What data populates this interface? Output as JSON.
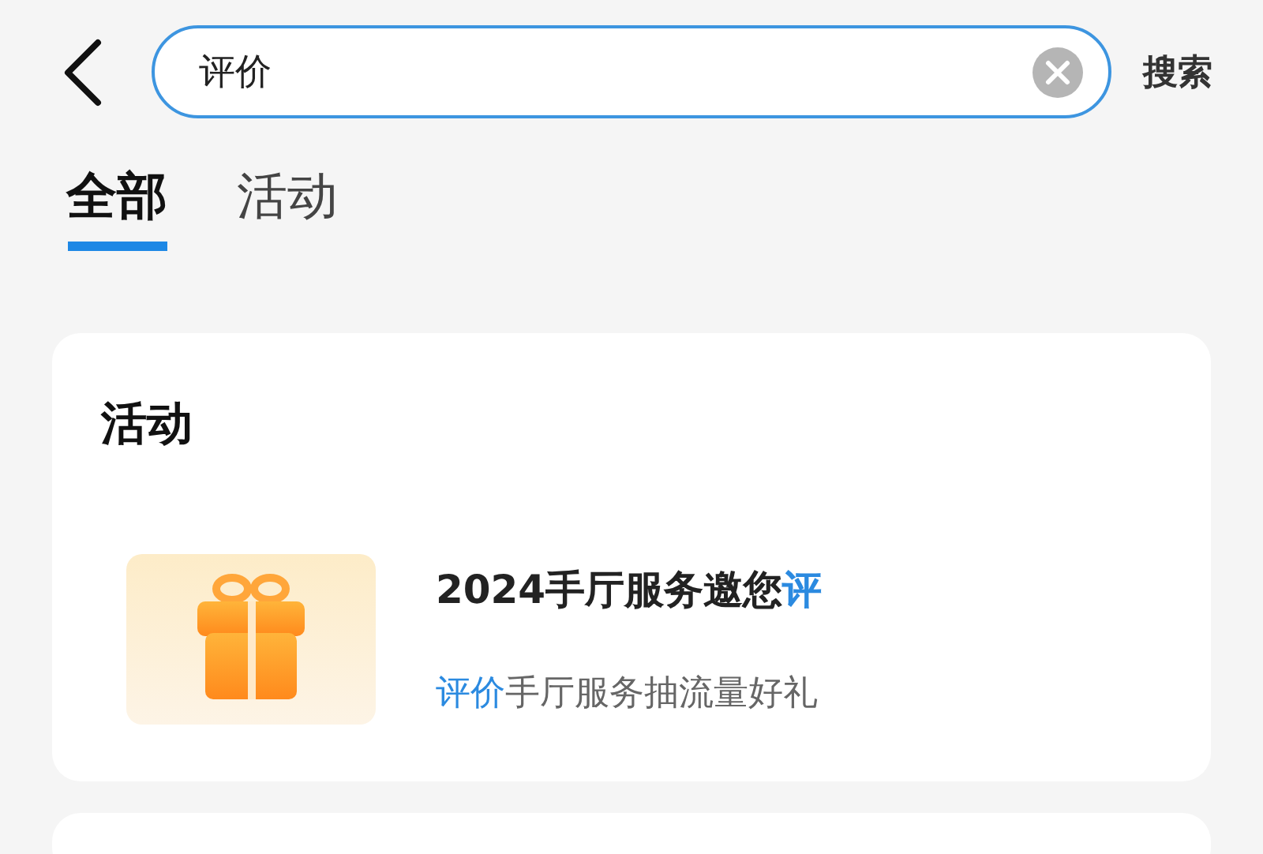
{
  "search": {
    "value": "评价",
    "submit": "搜索"
  },
  "tabs": [
    {
      "label": "全部",
      "selected": true
    },
    {
      "label": "活动",
      "selected": false
    }
  ],
  "sections": [
    {
      "title": "活动",
      "items": [
        {
          "title": [
            {
              "text": "2024手厅服务邀您",
              "highlight": false
            },
            {
              "text": "评",
              "highlight": true
            }
          ],
          "subtitle": [
            {
              "text": "评价",
              "highlight": true
            },
            {
              "text": "手厅服务抽流量好礼",
              "highlight": false
            }
          ]
        }
      ]
    }
  ]
}
